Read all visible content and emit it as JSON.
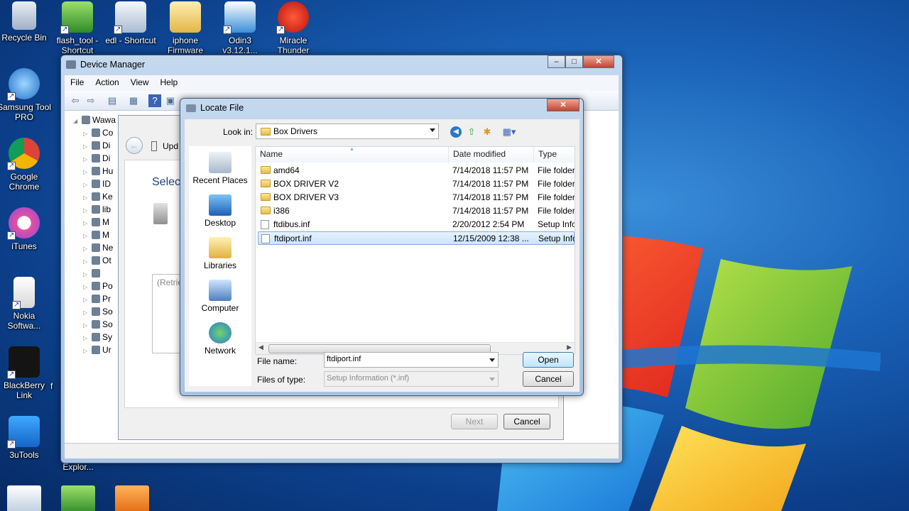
{
  "desktop": {
    "icons": [
      {
        "label": "Recycle Bin",
        "icon": "recycle-bin-icon"
      },
      {
        "label": "flash_tool - Shortcut",
        "icon": "flash-tool-icon"
      },
      {
        "label": "edl - Shortcut",
        "icon": "edl-icon"
      },
      {
        "label": "iphone Firmware",
        "icon": "folder-icon"
      },
      {
        "label": "Odin3 v3.12.1...",
        "icon": "odin-icon"
      },
      {
        "label": "Miracle Thunder",
        "icon": "miracle-icon"
      },
      {
        "label": "Samsung Tool PRO",
        "icon": "samsung-tool-icon"
      },
      {
        "label": "Google Chrome",
        "icon": "chrome-icon"
      },
      {
        "label": "iTunes",
        "icon": "itunes-icon"
      },
      {
        "label": "Nokia Softwa...",
        "icon": "nokia-icon"
      },
      {
        "label": "BlackBerry Link",
        "icon": "blackberry-icon"
      },
      {
        "label": "3uTools",
        "icon": "3utools-icon"
      }
    ],
    "partial_label_explorer": "Explor...",
    "partial_label_f": "f"
  },
  "device_manager": {
    "title": "Device Manager",
    "menu": [
      "File",
      "Action",
      "View",
      "Help"
    ],
    "tree_root": "Wawa",
    "tree_items": [
      "Co",
      "Di",
      "Di",
      "Hu",
      "ID",
      "Ke",
      "lib",
      "M",
      "M",
      "Ne",
      "Ot",
      "",
      "Po",
      "Pr",
      "So",
      "So",
      "Sy",
      "Ur"
    ]
  },
  "update_wizard": {
    "header_label": "Upd",
    "select_text": "Select",
    "retrieving_text": "(Retrie",
    "next_label": "Next",
    "cancel_label": "Cancel"
  },
  "locate_file": {
    "title": "Locate File",
    "look_in_label": "Look in:",
    "look_in_value": "Box Drivers",
    "places": [
      "Recent Places",
      "Desktop",
      "Libraries",
      "Computer",
      "Network"
    ],
    "columns": {
      "name": "Name",
      "date": "Date modified",
      "type": "Type"
    },
    "files": [
      {
        "name": "amd64",
        "date": "7/14/2018 11:57 PM",
        "type": "File folder",
        "kind": "folder"
      },
      {
        "name": "BOX DRIVER V2",
        "date": "7/14/2018 11:57 PM",
        "type": "File folder",
        "kind": "folder"
      },
      {
        "name": "BOX DRIVER V3",
        "date": "7/14/2018 11:57 PM",
        "type": "File folder",
        "kind": "folder"
      },
      {
        "name": "i386",
        "date": "7/14/2018 11:57 PM",
        "type": "File folder",
        "kind": "folder"
      },
      {
        "name": "ftdibus.inf",
        "date": "2/20/2012 2:54 PM",
        "type": "Setup Infc",
        "kind": "inf"
      },
      {
        "name": "ftdiport.inf",
        "date": "12/15/2009 12:38 ...",
        "type": "Setup Infc",
        "kind": "inf",
        "selected": true
      }
    ],
    "file_name_label": "File name:",
    "file_name_value": "ftdiport.inf",
    "files_of_type_label": "Files of type:",
    "files_of_type_value": "Setup Information (*.inf)",
    "open_label": "Open",
    "cancel_label": "Cancel"
  }
}
